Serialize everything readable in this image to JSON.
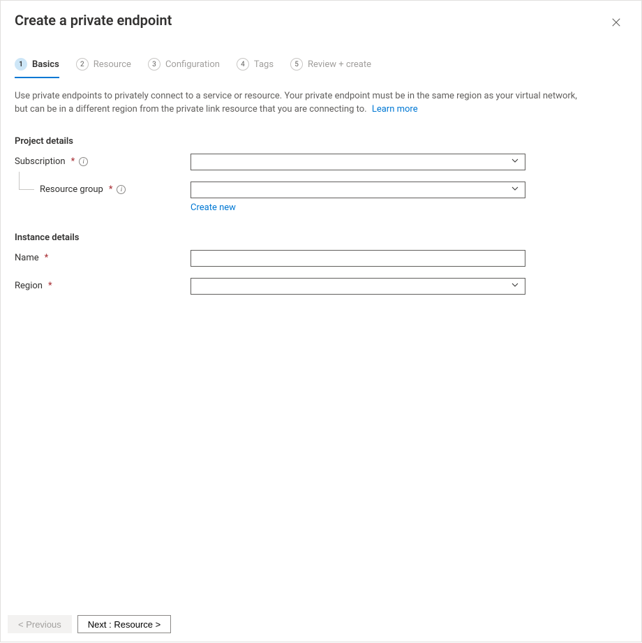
{
  "title": "Create a private endpoint",
  "tabs": [
    {
      "num": "1",
      "label": "Basics"
    },
    {
      "num": "2",
      "label": "Resource"
    },
    {
      "num": "3",
      "label": "Configuration"
    },
    {
      "num": "4",
      "label": "Tags"
    },
    {
      "num": "5",
      "label": "Review + create"
    }
  ],
  "intro_text": "Use private endpoints to privately connect to a service or resource. Your private endpoint must be in the same region as your virtual network, but can be in a different region from the private link resource that you are connecting to.",
  "learn_more": "Learn more",
  "sections": {
    "project_details": "Project details",
    "instance_details": "Instance details"
  },
  "fields": {
    "subscription": {
      "label": "Subscription",
      "value": ""
    },
    "resource_group": {
      "label": "Resource group",
      "value": "",
      "create_new": "Create new"
    },
    "name": {
      "label": "Name",
      "value": ""
    },
    "region": {
      "label": "Region",
      "value": ""
    }
  },
  "footer": {
    "previous": "< Previous",
    "next": "Next : Resource >"
  },
  "icons": {
    "info_glyph": "i"
  }
}
